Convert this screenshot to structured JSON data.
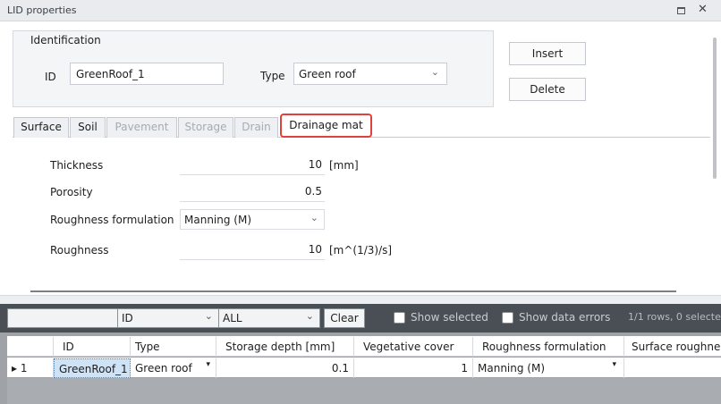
{
  "window": {
    "title": "LID properties"
  },
  "identification": {
    "legend": "Identification",
    "id_label": "ID",
    "id_value": "GreenRoof_1",
    "type_label": "Type",
    "type_value": "Green roof"
  },
  "buttons": {
    "insert": "Insert",
    "delete": "Delete"
  },
  "tabs": [
    {
      "label": "Surface",
      "enabled": true
    },
    {
      "label": "Soil",
      "enabled": true
    },
    {
      "label": "Pavement",
      "enabled": false
    },
    {
      "label": "Storage",
      "enabled": false
    },
    {
      "label": "Drain",
      "enabled": false
    },
    {
      "label": "Drainage mat",
      "enabled": true,
      "selected": true
    }
  ],
  "properties": {
    "thickness": {
      "label": "Thickness",
      "value": "10",
      "unit": "[mm]"
    },
    "porosity": {
      "label": "Porosity",
      "value": "0.5"
    },
    "roughness_formulation": {
      "label": "Roughness formulation",
      "value": "Manning (M)"
    },
    "roughness": {
      "label": "Roughness",
      "value": "10",
      "unit": "[m^(1/3)/s]"
    }
  },
  "filter": {
    "text": "",
    "column": "ID",
    "value": "ALL",
    "clear": "Clear",
    "show_selected": "Show selected",
    "show_data_errors": "Show data errors",
    "rows_info": "1/1 rows, 0 selecte"
  },
  "grid": {
    "columns": [
      "ID",
      "Type",
      "Storage depth [mm]",
      "Vegetative cover",
      "Roughness formulation",
      "Surface roughnes"
    ],
    "rows": [
      {
        "marker": "1",
        "id": "GreenRoof_1",
        "type": "Green roof",
        "storage_depth": "0.1",
        "vegetative_cover": "1",
        "roughness_formulation": "Manning (M)",
        "surface_roughness": ""
      }
    ]
  },
  "colors": {
    "highlight_tab_border": "#e0413a",
    "filter_bar": "#4a4e55",
    "selected_cell": "#cfe3f7"
  }
}
